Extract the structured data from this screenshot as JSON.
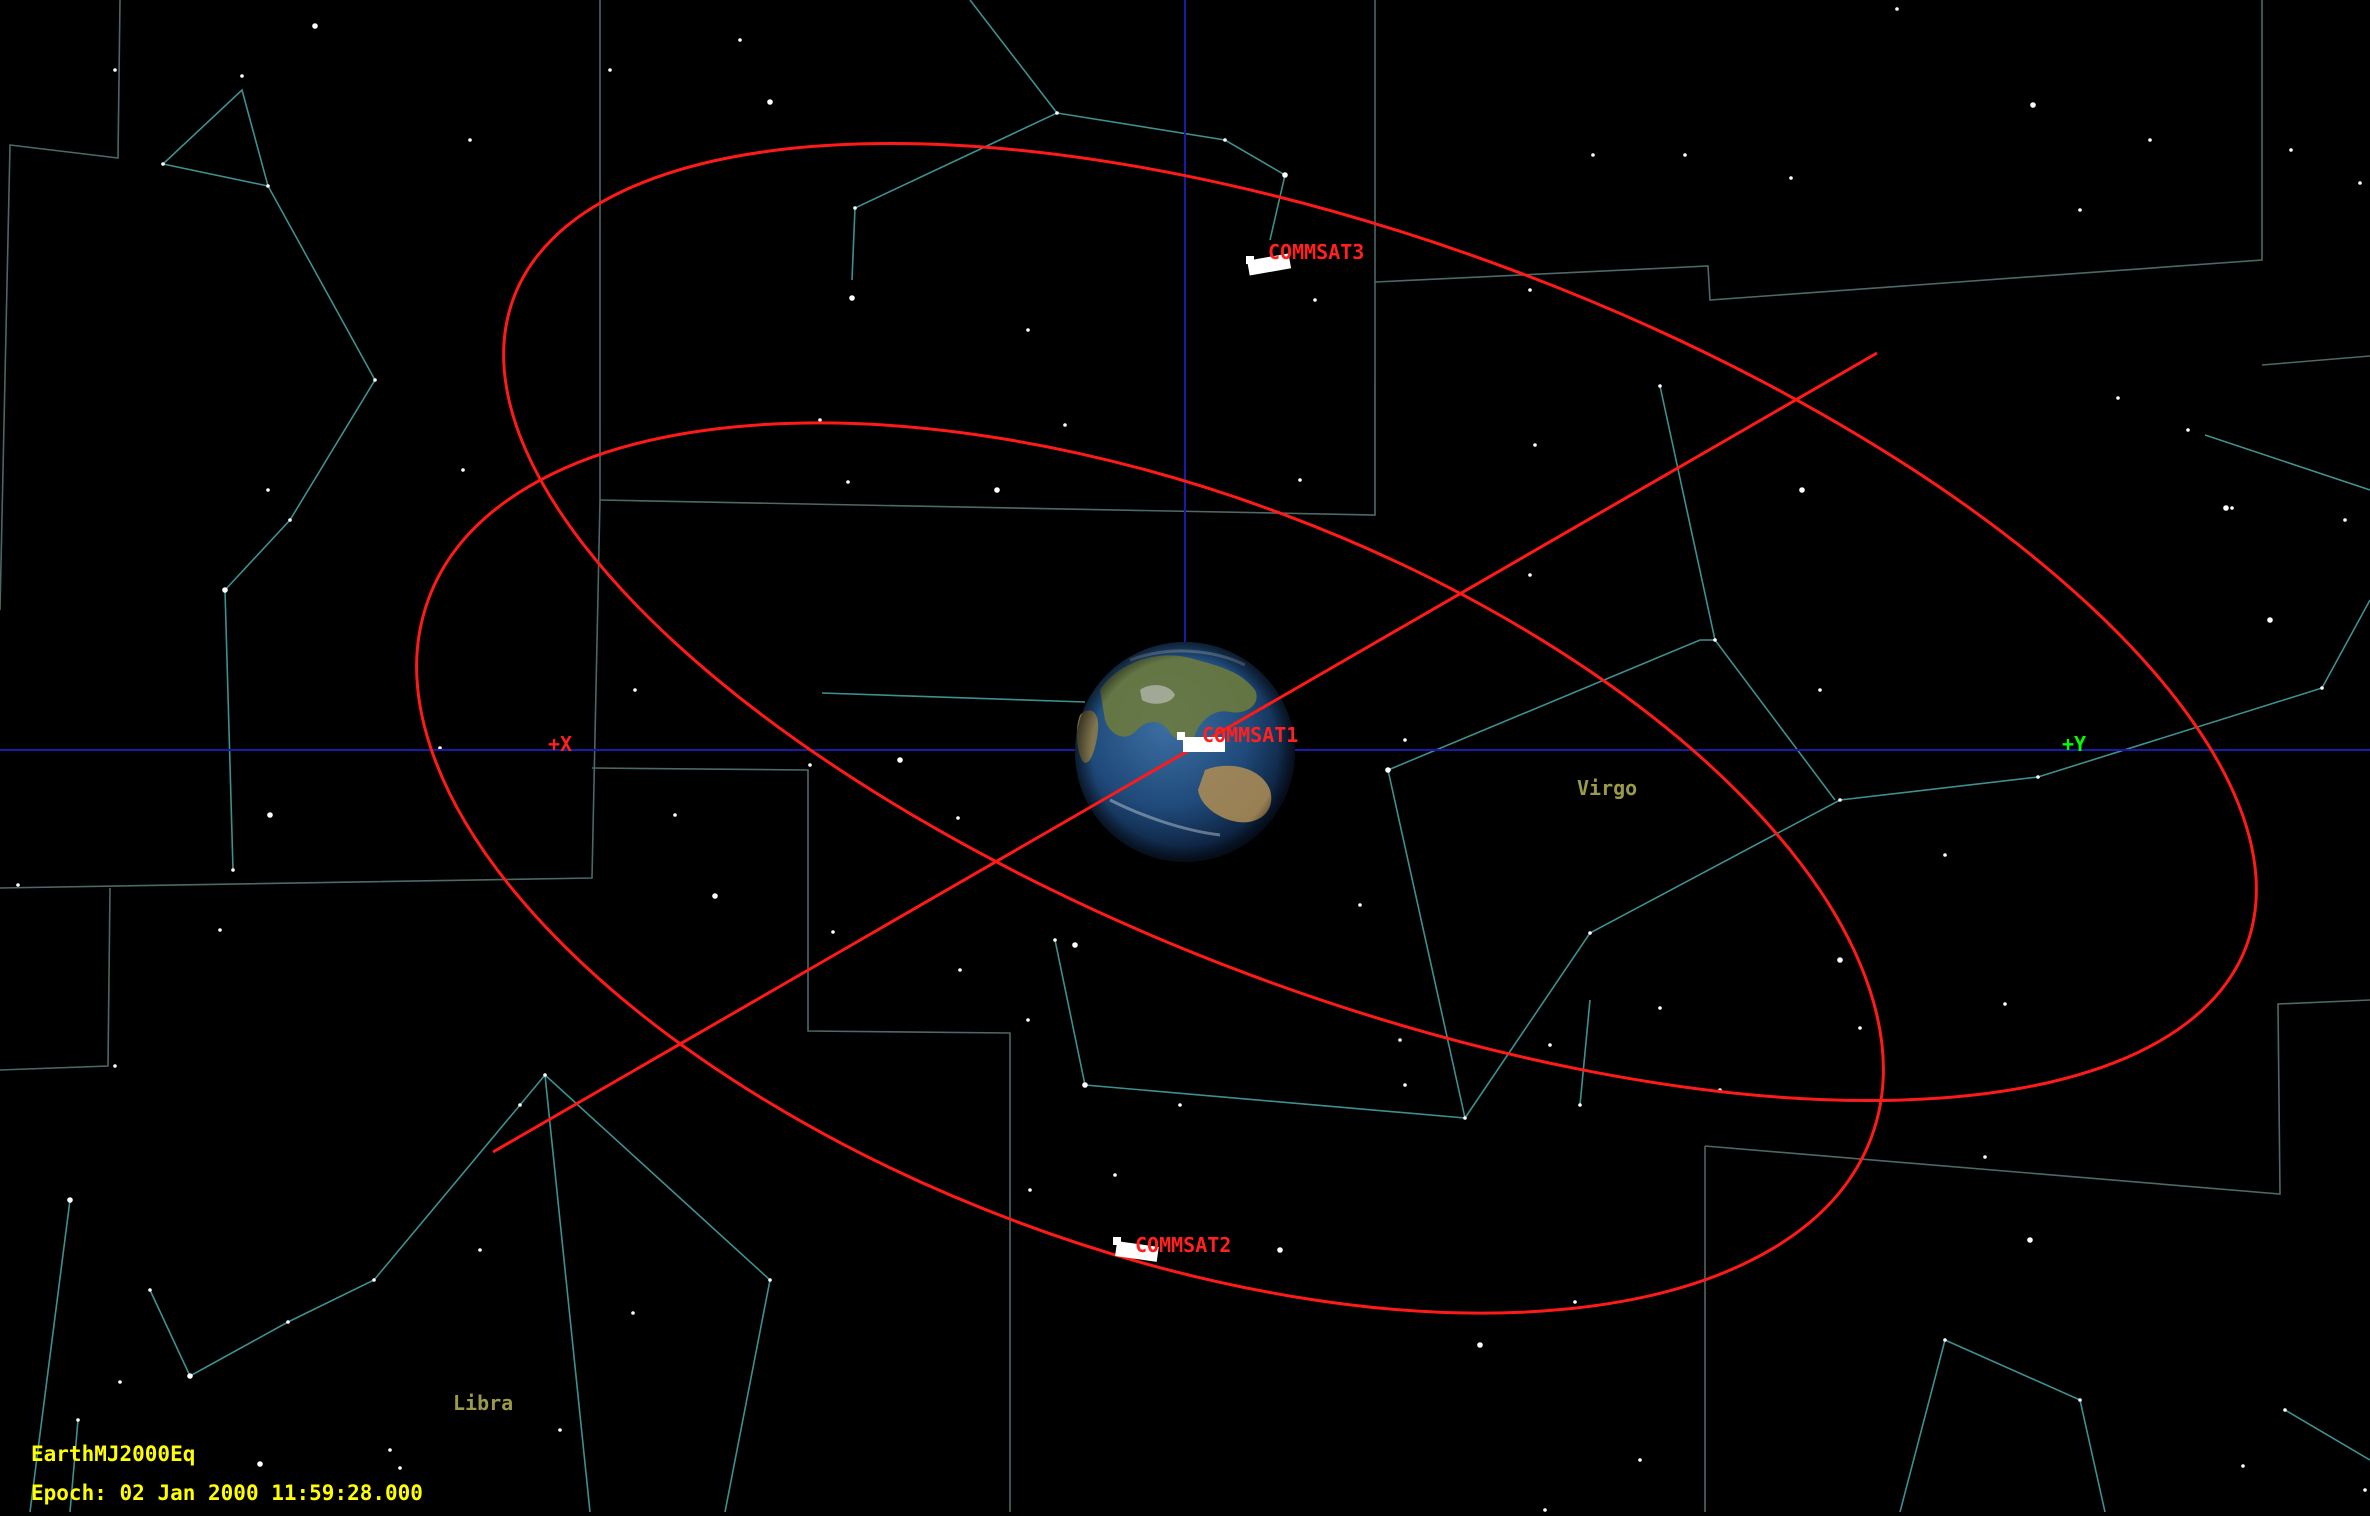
{
  "view": {
    "coordinate_system": "EarthMJ2000Eq",
    "epoch_label": "Epoch:",
    "epoch_value": "02 Jan 2000 11:59:28.000"
  },
  "axes": {
    "x_label": "+X",
    "y_label": "+Y",
    "x_color": "#ff2020",
    "y_color": "#00ff00"
  },
  "spacecraft": [
    {
      "name": "COMMSAT1"
    },
    {
      "name": "COMMSAT2"
    },
    {
      "name": "COMMSAT3"
    }
  ],
  "constellations": [
    {
      "name": "Virgo"
    },
    {
      "name": "Libra"
    }
  ],
  "colors": {
    "background": "#000000",
    "orbit": "#ff1a1a",
    "axis_lines": "#1a1aa8",
    "constellation_lines": "#3f8f8f",
    "constellation_labels": "#9a9a4a",
    "hud_text": "#ffff00",
    "stars": "#ffffff"
  }
}
